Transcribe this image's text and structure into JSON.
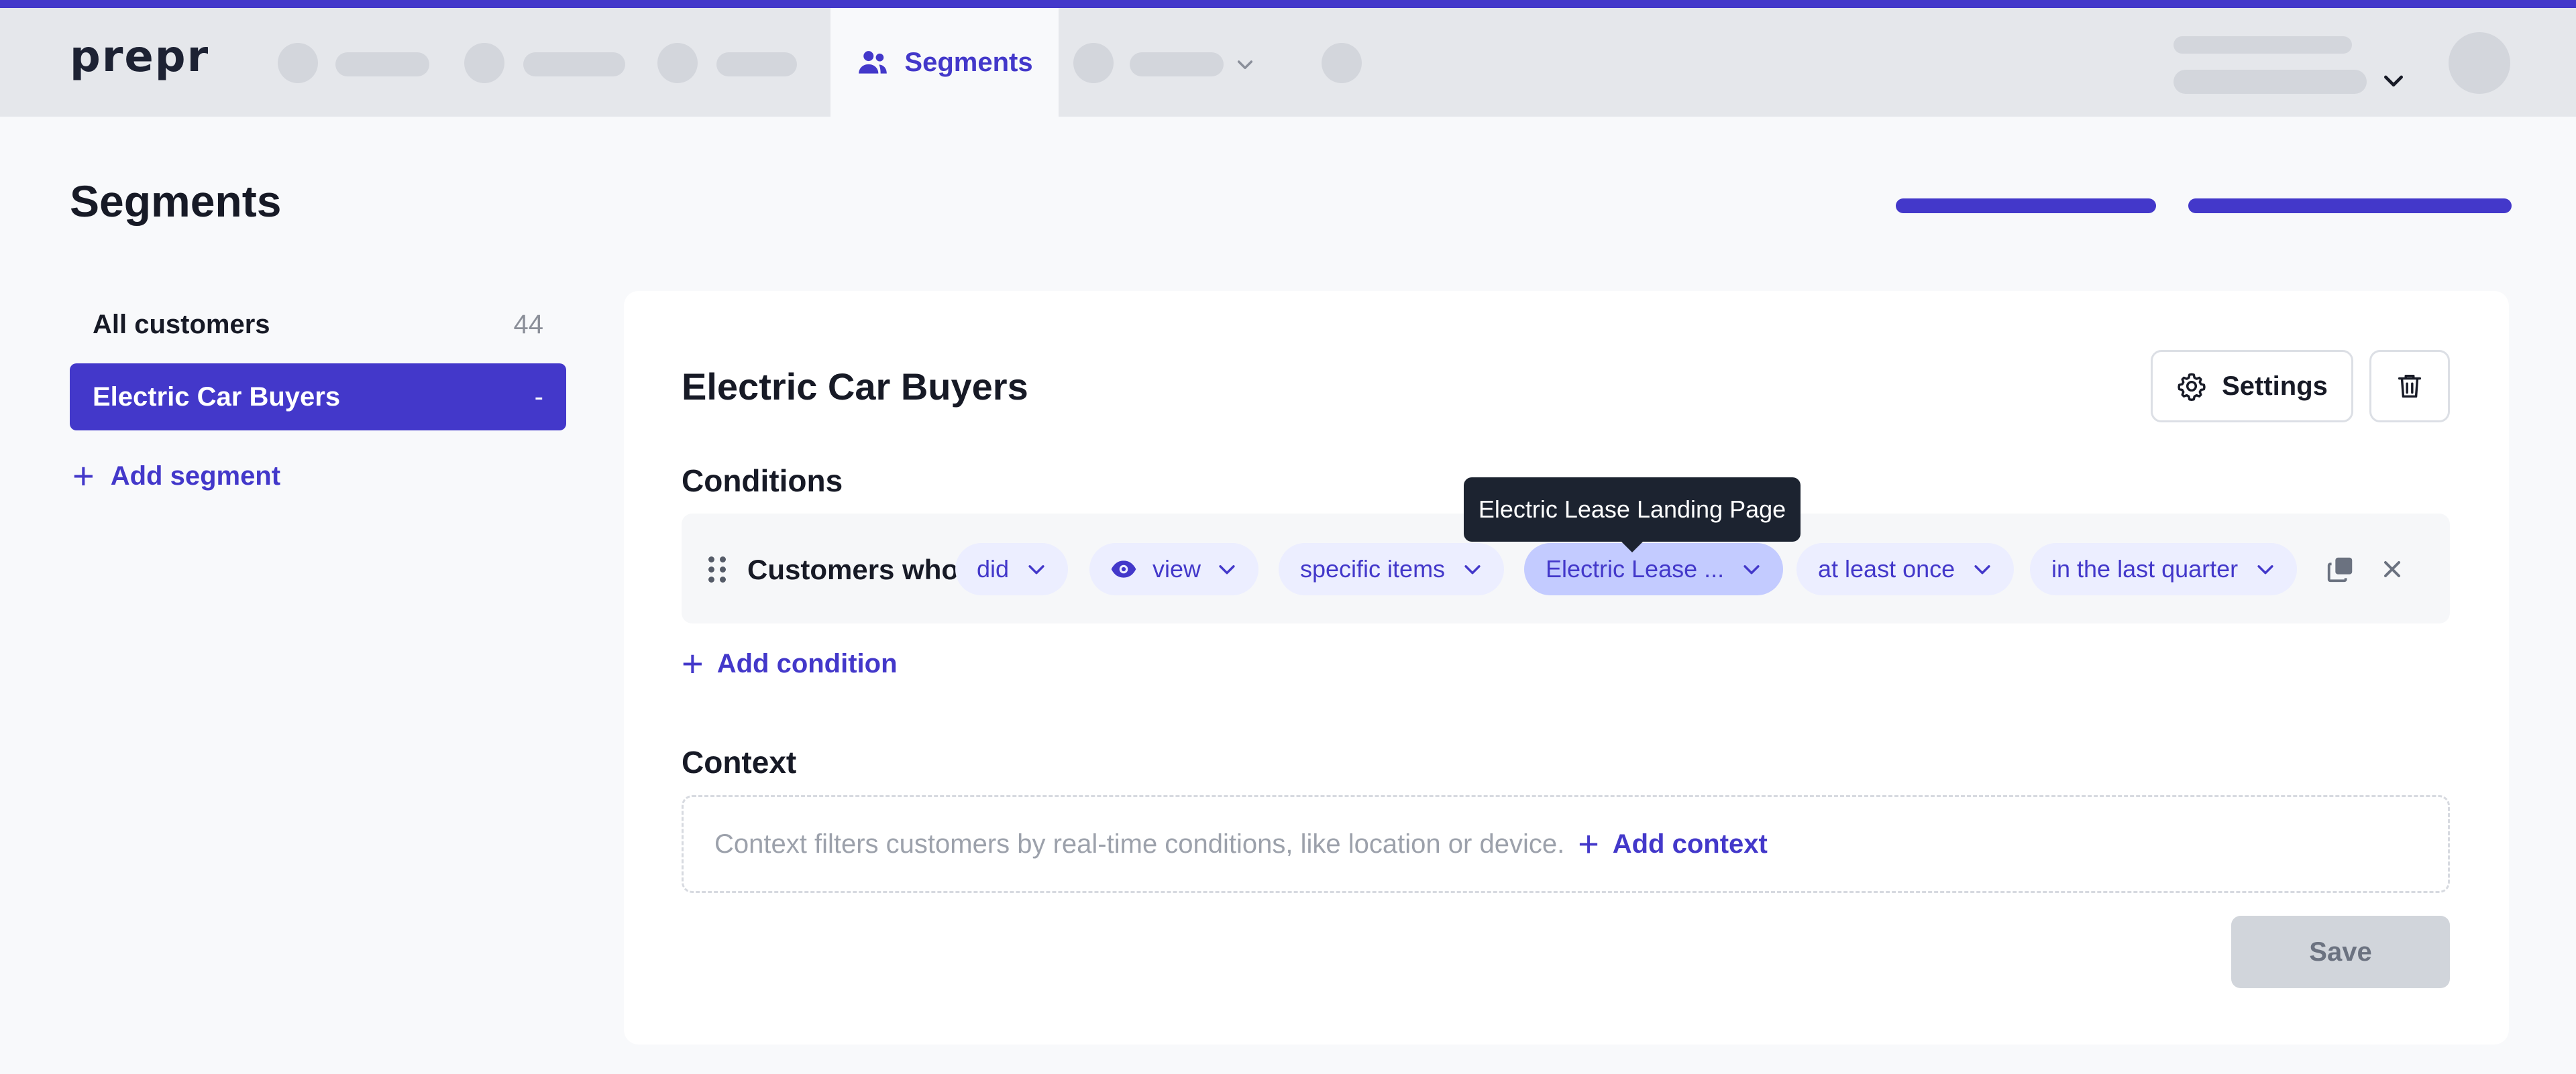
{
  "app": {
    "logo_text": "prepr"
  },
  "nav": {
    "active_tab": {
      "label": "Segments",
      "icon": "users-icon"
    }
  },
  "page": {
    "title": "Segments"
  },
  "sidebar": {
    "items": [
      {
        "label": "All customers",
        "count": "44",
        "active": false
      },
      {
        "label": "Electric Car Buyers",
        "count": "-",
        "active": true
      }
    ],
    "add_label": "Add segment"
  },
  "segment": {
    "title": "Electric Car Buyers",
    "settings_label": "Settings",
    "settings_icon": "gear-icon",
    "delete_icon": "trash-icon"
  },
  "conditions": {
    "title": "Conditions",
    "lead": "Customers who",
    "chips": [
      {
        "label": "did"
      },
      {
        "label": "view",
        "icon": "eye-icon"
      },
      {
        "label": "specific items"
      },
      {
        "label": "Electric Lease ...",
        "tooltip": "Electric Lease Landing Page"
      },
      {
        "label": "at least once"
      },
      {
        "label": "in the last quarter"
      }
    ],
    "add_label": "Add condition"
  },
  "context": {
    "title": "Context",
    "hint": "Context filters customers by real-time conditions, like location or device.",
    "add_label": "Add context"
  },
  "actions": {
    "save_label": "Save"
  },
  "colors": {
    "accent": "#4338ca",
    "chip_bg": "#eceeff",
    "chip_highlight": "#c3cbff",
    "nav_bg": "#e5e7eb"
  }
}
